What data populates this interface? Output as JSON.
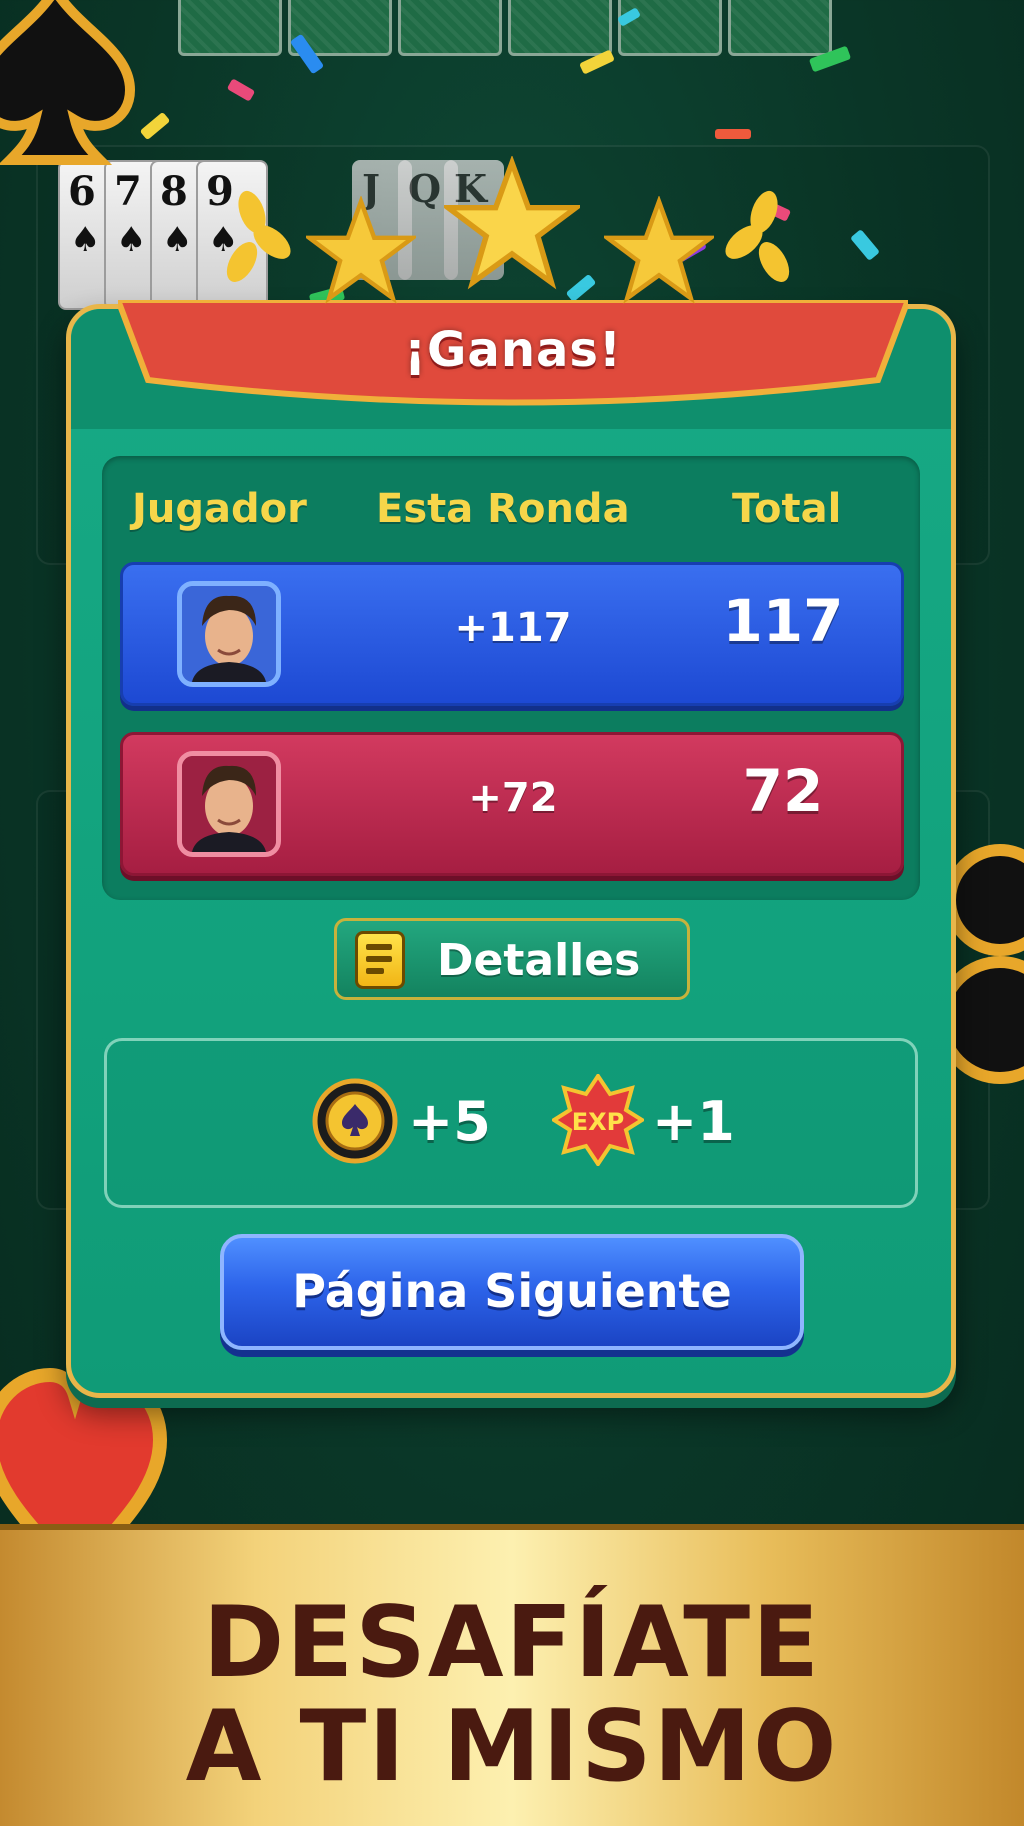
{
  "dialog": {
    "title": "¡Ganas!",
    "columns": {
      "player": "Jugador",
      "round": "Esta Ronda",
      "total": "Total"
    },
    "players": [
      {
        "round": "+117",
        "total": "117",
        "color": "#2a5ae4"
      },
      {
        "round": "+72",
        "total": "72",
        "color": "#bd2c52"
      }
    ],
    "details_label": "Detalles",
    "rewards": {
      "coins": "+5",
      "exp_badge": "EXP",
      "exp": "+1"
    },
    "next_label": "Página Siguiente"
  },
  "table": {
    "cards": [
      {
        "rank": "6",
        "suit": "♠"
      },
      {
        "rank": "7",
        "suit": "♠"
      },
      {
        "rank": "8",
        "suit": "♠"
      },
      {
        "rank": "9",
        "suit": "♠"
      }
    ],
    "face_cards": [
      "J",
      "Q",
      "K"
    ]
  },
  "banner": {
    "line1": "DESAFÍATE",
    "line2": "A TI MISMO"
  },
  "colors": {
    "felt": "#0a3627",
    "gold": "#e8b64a",
    "ribbon": "#e04a3c",
    "blue_button": "#2d64ea"
  }
}
